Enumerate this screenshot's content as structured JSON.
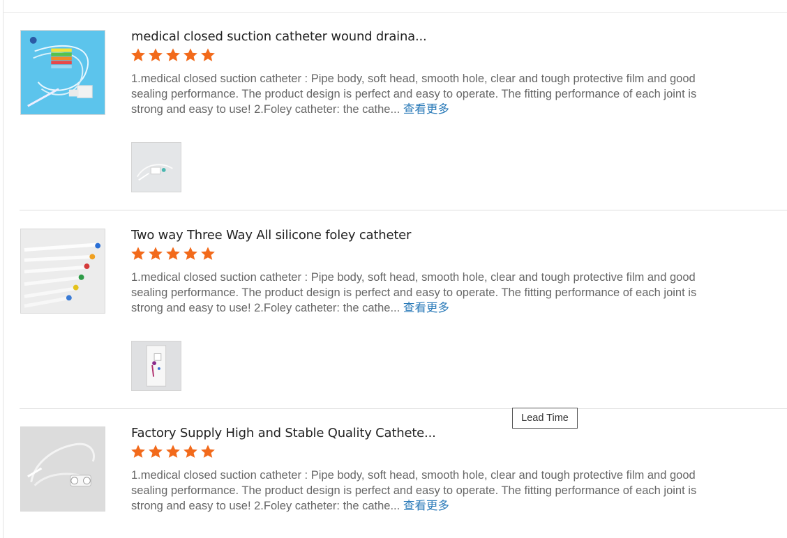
{
  "reviews": [
    {
      "title": "medical closed suction catheter wound draina...",
      "rating": 5,
      "description": "1.medical closed suction catheter : Pipe body, soft head, smooth hole, clear and tough protective film and good sealing performance. The product design is perfect and easy to operate. The fitting performance of each joint is strong and easy to use!     2.Foley catheter: the cathe...",
      "more_label": "查看更多",
      "thumbnail_icon": "catheter-product-image",
      "photo_icon": "review-photo"
    },
    {
      "title": "Two way Three Way All silicone foley catheter",
      "rating": 5,
      "description": "1.medical closed suction catheter : Pipe body, soft head, smooth hole, clear and tough protective film and good sealing performance. The product design is perfect and easy to operate. The fitting performance of each joint is strong and easy to use!     2.Foley catheter: the cathe...",
      "more_label": "查看更多",
      "thumbnail_icon": "foley-catheter-image",
      "photo_icon": "review-photo"
    },
    {
      "title": "Factory Supply High and Stable Quality Cathete...",
      "rating": 5,
      "description": "1.medical closed suction catheter : Pipe body, soft head, smooth hole, clear and tough protective film and good sealing performance. The product design is perfect and easy to operate. The fitting performance of each joint is strong and easy to use!     2.Foley catheter: the cathe...",
      "more_label": "查看更多",
      "thumbnail_icon": "suction-catheter-image"
    }
  ],
  "tooltip": {
    "label": "Lead Time"
  },
  "colors": {
    "star": "#f26a1b",
    "link": "#2a7ab8",
    "text": "#666666"
  }
}
